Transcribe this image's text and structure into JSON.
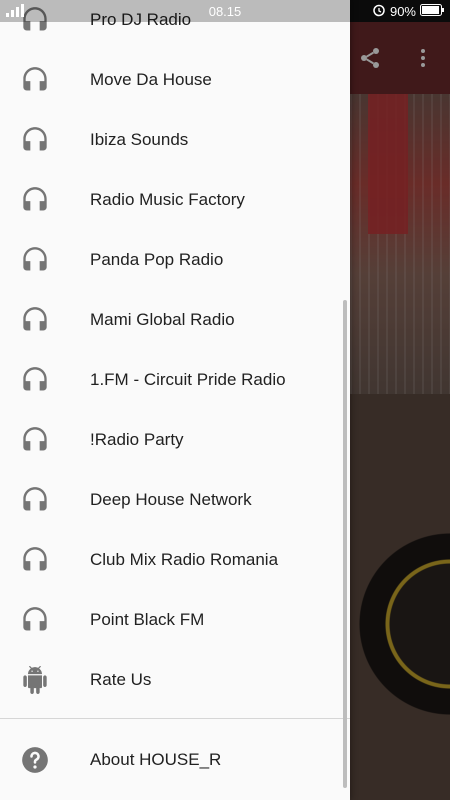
{
  "status_bar": {
    "time": "08.15",
    "battery": "90%"
  },
  "drawer": {
    "items": [
      {
        "label": "Pro DJ Radio",
        "icon": "headphones-icon"
      },
      {
        "label": "Move Da House",
        "icon": "headphones-icon"
      },
      {
        "label": "Ibiza Sounds",
        "icon": "headphones-icon"
      },
      {
        "label": "Radio Music Factory",
        "icon": "headphones-icon"
      },
      {
        "label": "Panda Pop Radio",
        "icon": "headphones-icon"
      },
      {
        "label": "Mami Global Radio",
        "icon": "headphones-icon"
      },
      {
        "label": "1.FM - Circuit Pride Radio",
        "icon": "headphones-icon"
      },
      {
        "label": "!Radio Party",
        "icon": "headphones-icon"
      },
      {
        "label": "Deep House Network",
        "icon": "headphones-icon"
      },
      {
        "label": "Club Mix Radio Romania",
        "icon": "headphones-icon"
      },
      {
        "label": "Point Black FM",
        "icon": "headphones-icon"
      },
      {
        "label": "Rate Us",
        "icon": "android-icon"
      }
    ],
    "footer_item": {
      "label": "About HOUSE_R",
      "icon": "help-icon"
    }
  },
  "colors": {
    "toolbar": "#6b2a2c",
    "icon_gray": "#757575",
    "drawer_bg": "#fafafa"
  }
}
